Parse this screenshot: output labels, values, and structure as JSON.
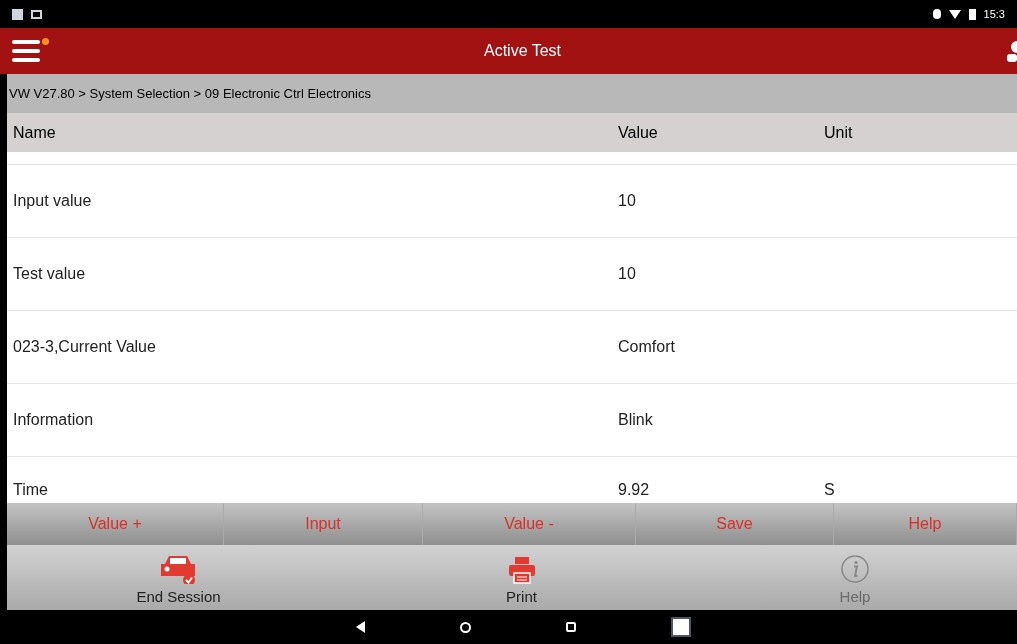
{
  "status_bar": {
    "time": "15:3"
  },
  "header": {
    "title": "Active Test",
    "menu_badge": true
  },
  "breadcrumb": "VW V27.80 > System Selection > 09 Electronic Ctrl Electronics",
  "table": {
    "columns": [
      "Name",
      "Value",
      "Unit"
    ],
    "rows": [
      {
        "name": "Input value",
        "value": "10",
        "unit": ""
      },
      {
        "name": "Test value",
        "value": "10",
        "unit": ""
      },
      {
        "name": "023-3,Current Value",
        "value": "Comfort",
        "unit": ""
      },
      {
        "name": "Information",
        "value": "Blink",
        "unit": ""
      },
      {
        "name": "Time",
        "value": "9.92",
        "unit": "S"
      }
    ]
  },
  "actions": [
    "Value +",
    "Input",
    "Value -",
    "Save",
    "Help"
  ],
  "toolbar": [
    {
      "kind": "car",
      "label": "End Session",
      "disabled": false
    },
    {
      "kind": "print",
      "label": "Print",
      "disabled": false
    },
    {
      "kind": "info",
      "label": "Help",
      "disabled": true
    }
  ]
}
